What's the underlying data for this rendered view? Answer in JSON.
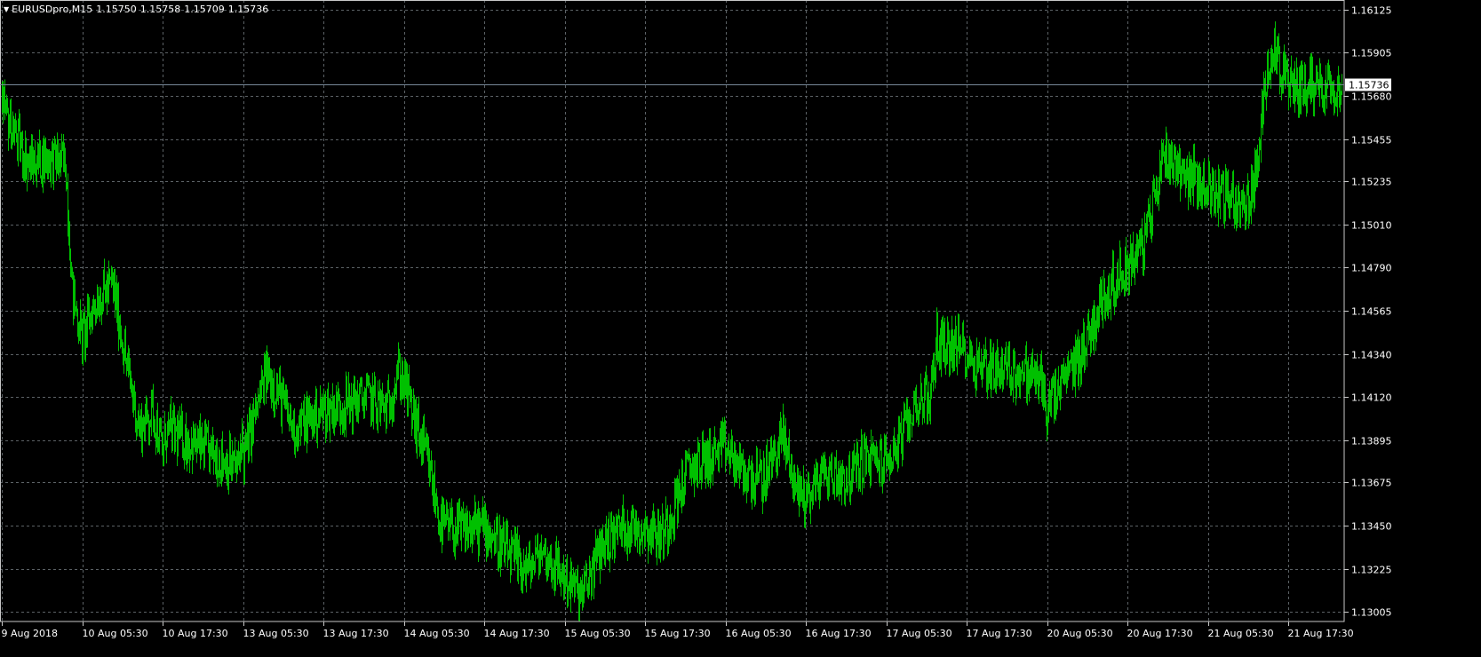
{
  "header": {
    "symbol": "EURUSDpro,M15",
    "open": "1.15750",
    "high": "1.15758",
    "low": "1.15709",
    "close": "1.15736"
  },
  "colors": {
    "background": "#000000",
    "grid": "#5c6266",
    "axis": "#c8c8c8",
    "text": "#ffffff",
    "price_line": "#778899",
    "bars": "#00c000"
  },
  "chart_data": {
    "type": "ohlc",
    "symbol": "EURUSDpro",
    "timeframe": "M15",
    "current_price": 1.15736,
    "ylim": [
      1.12955,
      1.16175
    ],
    "y_ticks": [
      "1.16125",
      "1.15905",
      "1.15680",
      "1.15455",
      "1.15235",
      "1.15010",
      "1.14790",
      "1.14565",
      "1.14340",
      "1.14120",
      "1.13895",
      "1.13675",
      "1.13450",
      "1.13225",
      "1.13005"
    ],
    "x_ticks": [
      "9 Aug 2018",
      "10 Aug 05:30",
      "10 Aug 17:30",
      "13 Aug 05:30",
      "13 Aug 17:30",
      "14 Aug 05:30",
      "14 Aug 17:30",
      "15 Aug 05:30",
      "15 Aug 17:30",
      "16 Aug 05:30",
      "16 Aug 17:30",
      "17 Aug 05:30",
      "17 Aug 17:30",
      "20 Aug 05:30",
      "20 Aug 17:30",
      "21 Aug 05:30",
      "21 Aug 17:30"
    ],
    "close_path": [
      [
        "9 Aug 2018",
        1.1562
      ],
      [
        "9 Aug 21:30",
        1.1532
      ],
      [
        "10 Aug 00:00",
        1.1536
      ],
      [
        "10 Aug 03:00",
        1.1533
      ],
      [
        "10 Aug 04:00",
        1.1465
      ],
      [
        "10 Aug 05:30",
        1.1442
      ],
      [
        "10 Aug 07:30",
        1.1462
      ],
      [
        "10 Aug 10:00",
        1.147
      ],
      [
        "10 Aug 12:00",
        1.143
      ],
      [
        "10 Aug 14:00",
        1.1395
      ],
      [
        "10 Aug 16:00",
        1.1405
      ],
      [
        "10 Aug 17:30",
        1.1382
      ],
      [
        "10 Aug 20:00",
        1.1395
      ],
      [
        "13 Aug 02:00",
        1.1375
      ],
      [
        "13 Aug 04:00",
        1.1395
      ],
      [
        "13 Aug 05:30",
        1.138
      ],
      [
        "13 Aug 09:00",
        1.1425
      ],
      [
        "13 Aug 11:00",
        1.1412
      ],
      [
        "13 Aug 13:00",
        1.1395
      ],
      [
        "13 Aug 17:30",
        1.1405
      ],
      [
        "13 Aug 21:00",
        1.1408
      ],
      [
        "14 Aug 00:00",
        1.1412
      ],
      [
        "14 Aug 03:00",
        1.1405
      ],
      [
        "14 Aug 04:30",
        1.1425
      ],
      [
        "14 Aug 05:30",
        1.142
      ],
      [
        "14 Aug 07:00",
        1.14
      ],
      [
        "14 Aug 09:00",
        1.1378
      ],
      [
        "14 Aug 11:00",
        1.1345
      ],
      [
        "14 Aug 14:00",
        1.1342
      ],
      [
        "14 Aug 17:30",
        1.1345
      ],
      [
        "14 Aug 21:00",
        1.133
      ],
      [
        "15 Aug 00:00",
        1.1322
      ],
      [
        "15 Aug 02:00",
        1.1332
      ],
      [
        "15 Aug 05:30",
        1.1318
      ],
      [
        "15 Aug 08:00",
        1.1308
      ],
      [
        "15 Aug 11:00",
        1.1335
      ],
      [
        "15 Aug 14:00",
        1.1345
      ],
      [
        "15 Aug 17:30",
        1.1344
      ],
      [
        "15 Aug 20:00",
        1.134
      ],
      [
        "16 Aug 00:00",
        1.1375
      ],
      [
        "16 Aug 05:30",
        1.1385
      ],
      [
        "16 Aug 08:00",
        1.1372
      ],
      [
        "16 Aug 11:00",
        1.1368
      ],
      [
        "16 Aug 14:00",
        1.1392
      ],
      [
        "16 Aug 16:00",
        1.1365
      ],
      [
        "16 Aug 17:30",
        1.136
      ],
      [
        "16 Aug 20:00",
        1.1372
      ],
      [
        "17 Aug 00:00",
        1.137
      ],
      [
        "17 Aug 02:00",
        1.138
      ],
      [
        "17 Aug 05:30",
        1.1378
      ],
      [
        "17 Aug 08:00",
        1.1392
      ],
      [
        "17 Aug 10:00",
        1.141
      ],
      [
        "17 Aug 12:00",
        1.1412
      ],
      [
        "17 Aug 13:00",
        1.144
      ],
      [
        "17 Aug 17:30",
        1.1436
      ],
      [
        "17 Aug 21:00",
        1.143
      ],
      [
        "20 Aug 00:00",
        1.1422
      ],
      [
        "20 Aug 03:00",
        1.1412
      ],
      [
        "20 Aug 05:30",
        1.1405
      ],
      [
        "20 Aug 08:00",
        1.142
      ],
      [
        "20 Aug 11:00",
        1.1438
      ],
      [
        "20 Aug 14:00",
        1.1465
      ],
      [
        "20 Aug 17:30",
        1.148
      ],
      [
        "20 Aug 20:00",
        1.1492
      ],
      [
        "20 Aug 23:00",
        1.154
      ],
      [
        "21 Aug 02:00",
        1.1528
      ],
      [
        "21 Aug 05:30",
        1.152
      ],
      [
        "21 Aug 09:00",
        1.1515
      ],
      [
        "21 Aug 11:00",
        1.1508
      ],
      [
        "21 Aug 13:00",
        1.1532
      ],
      [
        "21 Aug 14:00",
        1.1575
      ],
      [
        "21 Aug 15:00",
        1.1595
      ],
      [
        "21 Aug 17:30",
        1.1571
      ],
      [
        "21 Aug 20:00",
        1.1574
      ]
    ]
  }
}
